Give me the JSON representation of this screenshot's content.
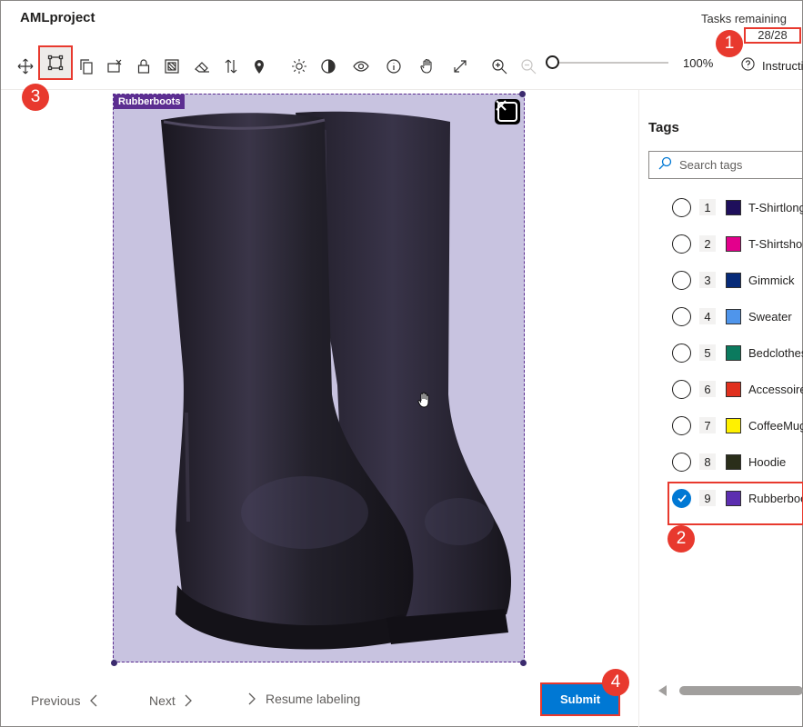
{
  "app": {
    "title": "AMLproject"
  },
  "tasks": {
    "label": "Tasks remaining",
    "count": "28/28"
  },
  "toolbar": {
    "tools": [
      {
        "icon": "move-icon",
        "active": false
      },
      {
        "icon": "rectangular-box-icon",
        "active": true
      },
      {
        "icon": "copy-icon",
        "active": false
      },
      {
        "icon": "clear-boxes-icon",
        "active": false
      },
      {
        "icon": "lock-icon",
        "active": false
      },
      {
        "icon": "select-region-icon",
        "active": false
      },
      {
        "icon": "eraser-icon",
        "active": false
      },
      {
        "icon": "swap-icon",
        "active": false
      },
      {
        "icon": "pin-icon",
        "active": false
      },
      {
        "icon": "brightness-icon",
        "active": false
      },
      {
        "icon": "contrast-icon",
        "active": false
      },
      {
        "icon": "visibility-icon",
        "active": false
      },
      {
        "icon": "info-icon",
        "active": false
      },
      {
        "icon": "pan-hand-icon",
        "active": false
      },
      {
        "icon": "fit-expand-icon",
        "active": false
      },
      {
        "icon": "zoom-in-icon",
        "active": false
      },
      {
        "icon": "zoom-out-icon",
        "active": false
      }
    ],
    "zoom_value": "100%",
    "zoom_level": 0,
    "instructions_label": "Instructions"
  },
  "canvas": {
    "box_tag_label": "Rubberboots",
    "box_color": "#5c2e91"
  },
  "tags": {
    "title": "Tags",
    "search_placeholder": "Search tags",
    "items": [
      {
        "num": "1",
        "name": "T-Shirtlong",
        "color": "#1f0f5c",
        "checked": false
      },
      {
        "num": "2",
        "name": "T-Shirtshort",
        "color": "#e3008c",
        "checked": false
      },
      {
        "num": "3",
        "name": "Gimmick",
        "color": "#062a78",
        "checked": false
      },
      {
        "num": "4",
        "name": "Sweater",
        "color": "#4f95eb",
        "checked": false
      },
      {
        "num": "5",
        "name": "Bedclothes",
        "color": "#0b7a5e",
        "checked": false
      },
      {
        "num": "6",
        "name": "Accessoires",
        "color": "#e0301e",
        "checked": false
      },
      {
        "num": "7",
        "name": "CoffeeMugs",
        "color": "#fff100",
        "checked": false
      },
      {
        "num": "8",
        "name": "Hoodie",
        "color": "#2a2e1a",
        "checked": false
      },
      {
        "num": "9",
        "name": "Rubberboots",
        "color": "#5c2eb0",
        "checked": true
      }
    ]
  },
  "footer": {
    "previous_label": "Previous",
    "next_label": "Next",
    "resume_label": "Resume labeling",
    "submit_label": "Submit"
  },
  "callouts": [
    "1",
    "2",
    "3",
    "4"
  ],
  "colors": {
    "accent": "#0078d4",
    "highlight": "#e8392e"
  }
}
